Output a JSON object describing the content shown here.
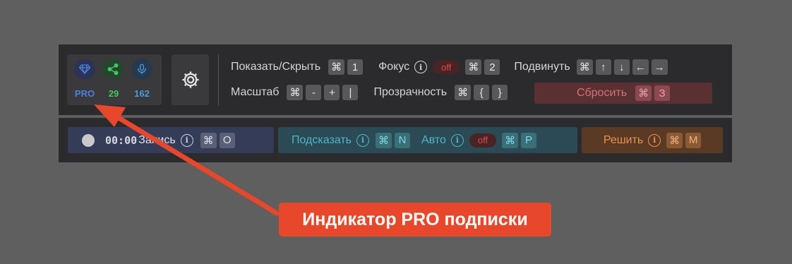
{
  "status": {
    "pro_label": "PRO",
    "share_count": "29",
    "mic_count": "162",
    "colors": {
      "pro": "#4a7fe0",
      "share": "#3fc85f",
      "mic": "#4b9ad8"
    }
  },
  "row1": {
    "show_hide": "Показать/Скрыть",
    "show_hide_keys": [
      "⌘",
      "1"
    ],
    "focus": "Фокус",
    "focus_toggle": "off",
    "focus_keys": [
      "⌘",
      "2"
    ],
    "move": "Подвинуть",
    "move_keys": [
      "⌘",
      "↑",
      "↓",
      "←",
      "→"
    ]
  },
  "row2": {
    "scale": "Масштаб",
    "scale_keys": [
      "⌘",
      "-",
      "+",
      "|"
    ],
    "opacity": "Прозрачность",
    "opacity_keys": [
      "⌘",
      "{",
      "}"
    ],
    "reset": "Сбросить",
    "reset_keys": [
      "⌘",
      "З"
    ]
  },
  "bottom": {
    "timer": "00:00",
    "record": "Запись",
    "record_keys": [
      "⌘",
      "O"
    ],
    "hint": "Подсказать",
    "hint_keys": [
      "⌘",
      "N"
    ],
    "auto": "Авто",
    "auto_toggle": "off",
    "auto_keys": [
      "⌘",
      "P"
    ],
    "solve": "Решить",
    "solve_keys": [
      "⌘",
      "M"
    ]
  },
  "callout": {
    "text": "Индикатор PRO подписки",
    "color": "#e8472b"
  }
}
